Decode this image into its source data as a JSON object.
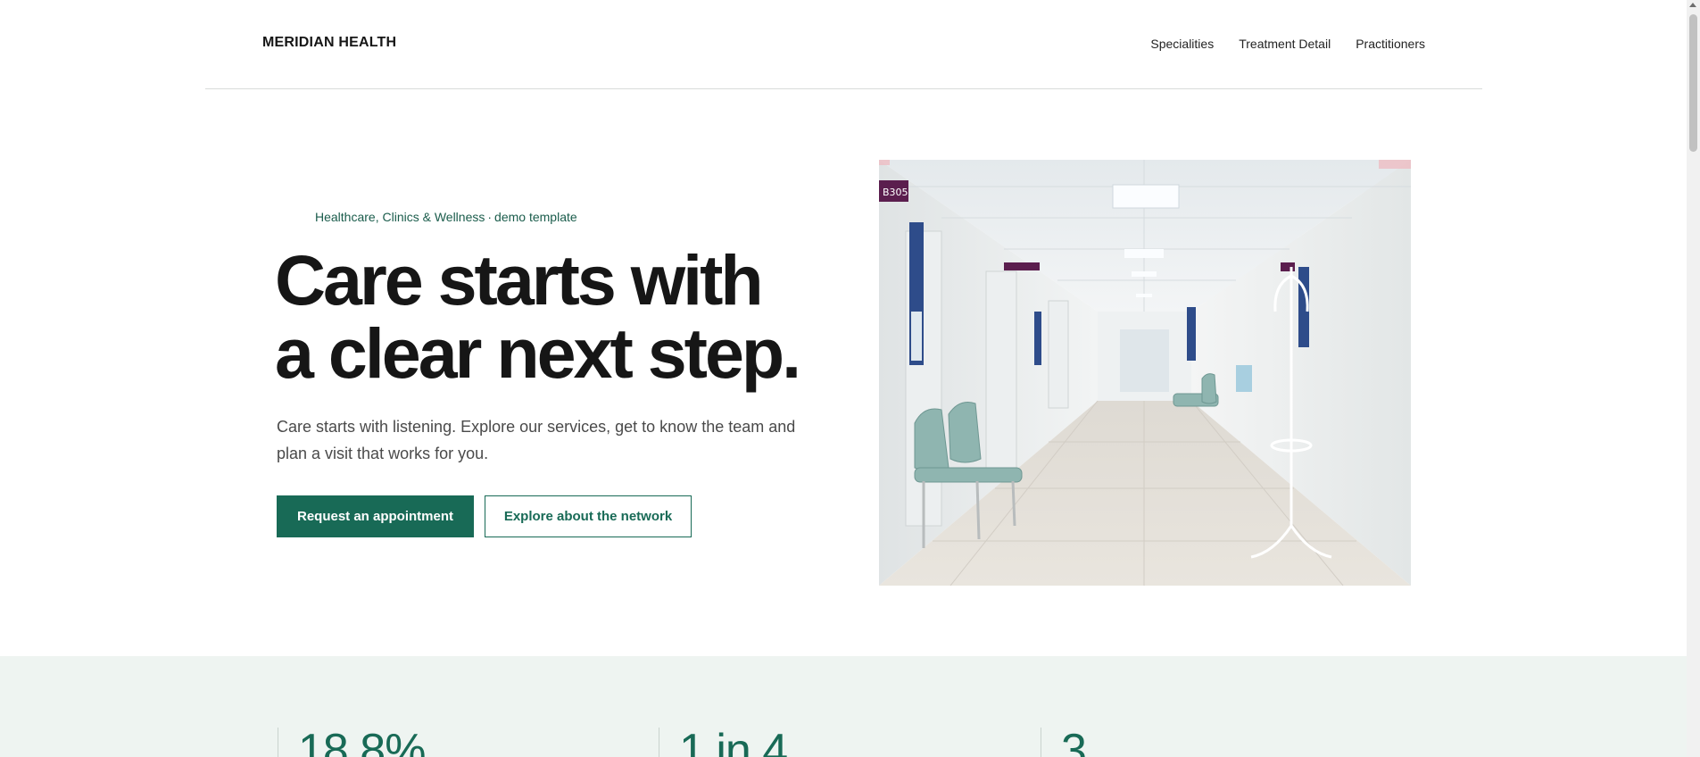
{
  "header": {
    "brand": "MERIDIAN HEALTH",
    "nav": [
      "Specialities",
      "Treatment Detail",
      "Practitioners"
    ]
  },
  "hero": {
    "eyebrow_left": "Healthcare, Clinics & Wellness",
    "eyebrow_separator": "·",
    "eyebrow_right": "demo template",
    "title_line1": "Care starts with",
    "title_line2": "a clear next step.",
    "subtitle": "Care starts with listening. Explore our services, get to know the team and plan a visit that works for you.",
    "primary_cta": "Request an appointment",
    "secondary_cta": "Explore about the network",
    "image_sign": "B305"
  },
  "stats": [
    {
      "value": "18.8%"
    },
    {
      "value": "1 in 4"
    },
    {
      "value": "3"
    }
  ],
  "colors": {
    "accent": "#186a56",
    "stats_background": "#eef4f1",
    "text": "#161616"
  }
}
